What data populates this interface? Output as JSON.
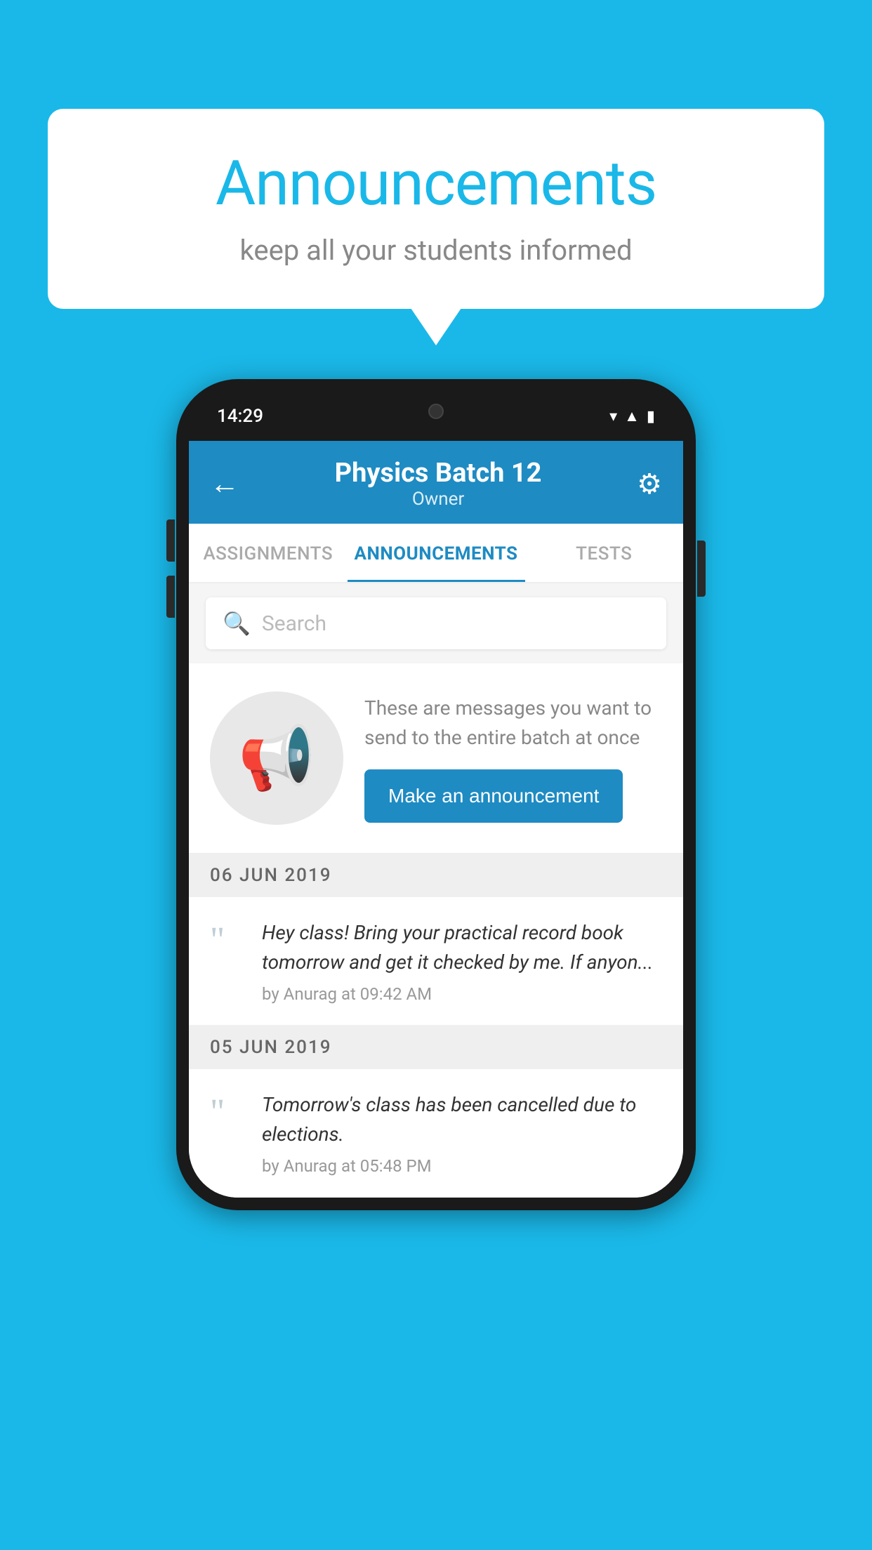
{
  "background_color": "#1ab8e8",
  "speech_bubble": {
    "title": "Announcements",
    "subtitle": "keep all your students informed"
  },
  "phone": {
    "status_bar": {
      "time": "14:29"
    },
    "header": {
      "title": "Physics Batch 12",
      "subtitle": "Owner",
      "back_label": "←",
      "gear_label": "⚙"
    },
    "tabs": [
      {
        "label": "ASSIGNMENTS",
        "active": false
      },
      {
        "label": "ANNOUNCEMENTS",
        "active": true
      },
      {
        "label": "TESTS",
        "active": false
      }
    ],
    "search": {
      "placeholder": "Search"
    },
    "promo": {
      "text": "These are messages you want to send to the entire batch at once",
      "button_label": "Make an announcement"
    },
    "announcements": [
      {
        "date": "06  JUN  2019",
        "message": "Hey class! Bring your practical record book tomorrow and get it checked by me. If anyon...",
        "meta": "by Anurag at 09:42 AM"
      },
      {
        "date": "05  JUN  2019",
        "message": "Tomorrow's class has been cancelled due to elections.",
        "meta": "by Anurag at 05:48 PM"
      }
    ]
  }
}
